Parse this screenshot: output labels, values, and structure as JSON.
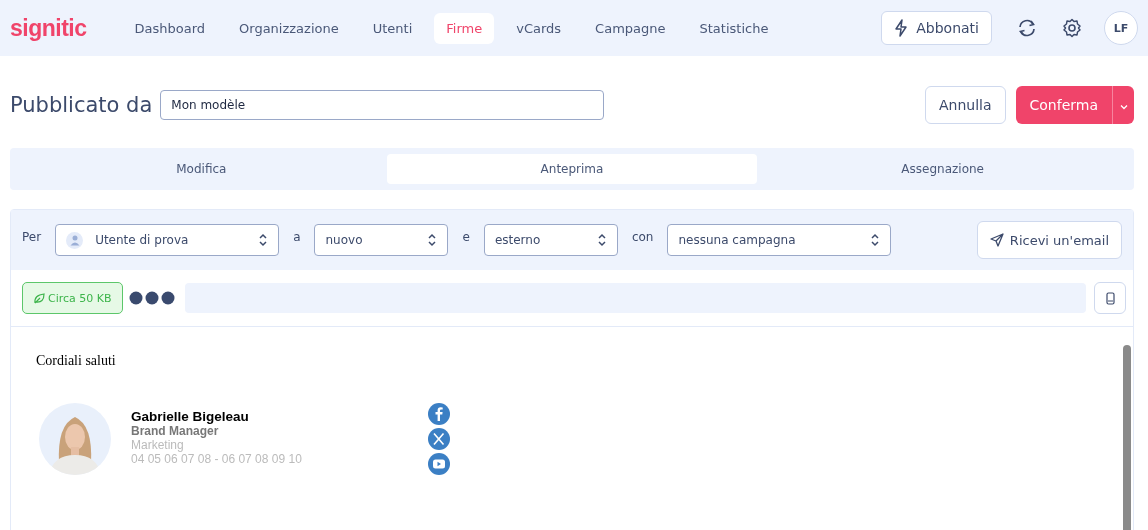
{
  "nav": {
    "logo": "signitic",
    "items": [
      {
        "label": "Dashboard",
        "selected": false
      },
      {
        "label": "Organizzazione",
        "selected": false
      },
      {
        "label": "Utenti",
        "selected": false
      },
      {
        "label": "Firme",
        "selected": true
      },
      {
        "label": "vCards",
        "selected": false
      },
      {
        "label": "Campagne",
        "selected": false
      },
      {
        "label": "Statistiche",
        "selected": false
      }
    ],
    "subscribe_button": "Abbonati",
    "avatar_initials": "LF"
  },
  "header": {
    "title": "Pubblicato da",
    "name_field": "Mon modèle",
    "cancel_button": "Annulla",
    "confirm_button": "Conferma"
  },
  "tabs": [
    {
      "label": "Modifica",
      "selected": false
    },
    {
      "label": "Anteprima",
      "selected": true
    },
    {
      "label": "Assegnazione",
      "selected": false
    }
  ],
  "filters": [
    {
      "label": "Per",
      "value": "Utente di prova",
      "kind": "user"
    },
    {
      "label": "a",
      "value": "nuovo",
      "kind": "plain"
    },
    {
      "label": "e",
      "value": "esterno",
      "kind": "plain"
    },
    {
      "label": "con",
      "value": "nessuna campagna",
      "kind": "plain"
    }
  ],
  "send_button": "Ricevi un'email",
  "size_badge": "Circa 50 KB",
  "signature": {
    "greeting": "Cordiali saluti",
    "name": "Gabrielle Bigeleau",
    "job_title": "Brand Manager",
    "department": "Marketing",
    "phone": "04 05 06 07 08 - 06 07 08 09 10",
    "social": [
      {
        "kind": "facebook"
      },
      {
        "kind": "x"
      },
      {
        "kind": "youtube"
      }
    ]
  }
}
